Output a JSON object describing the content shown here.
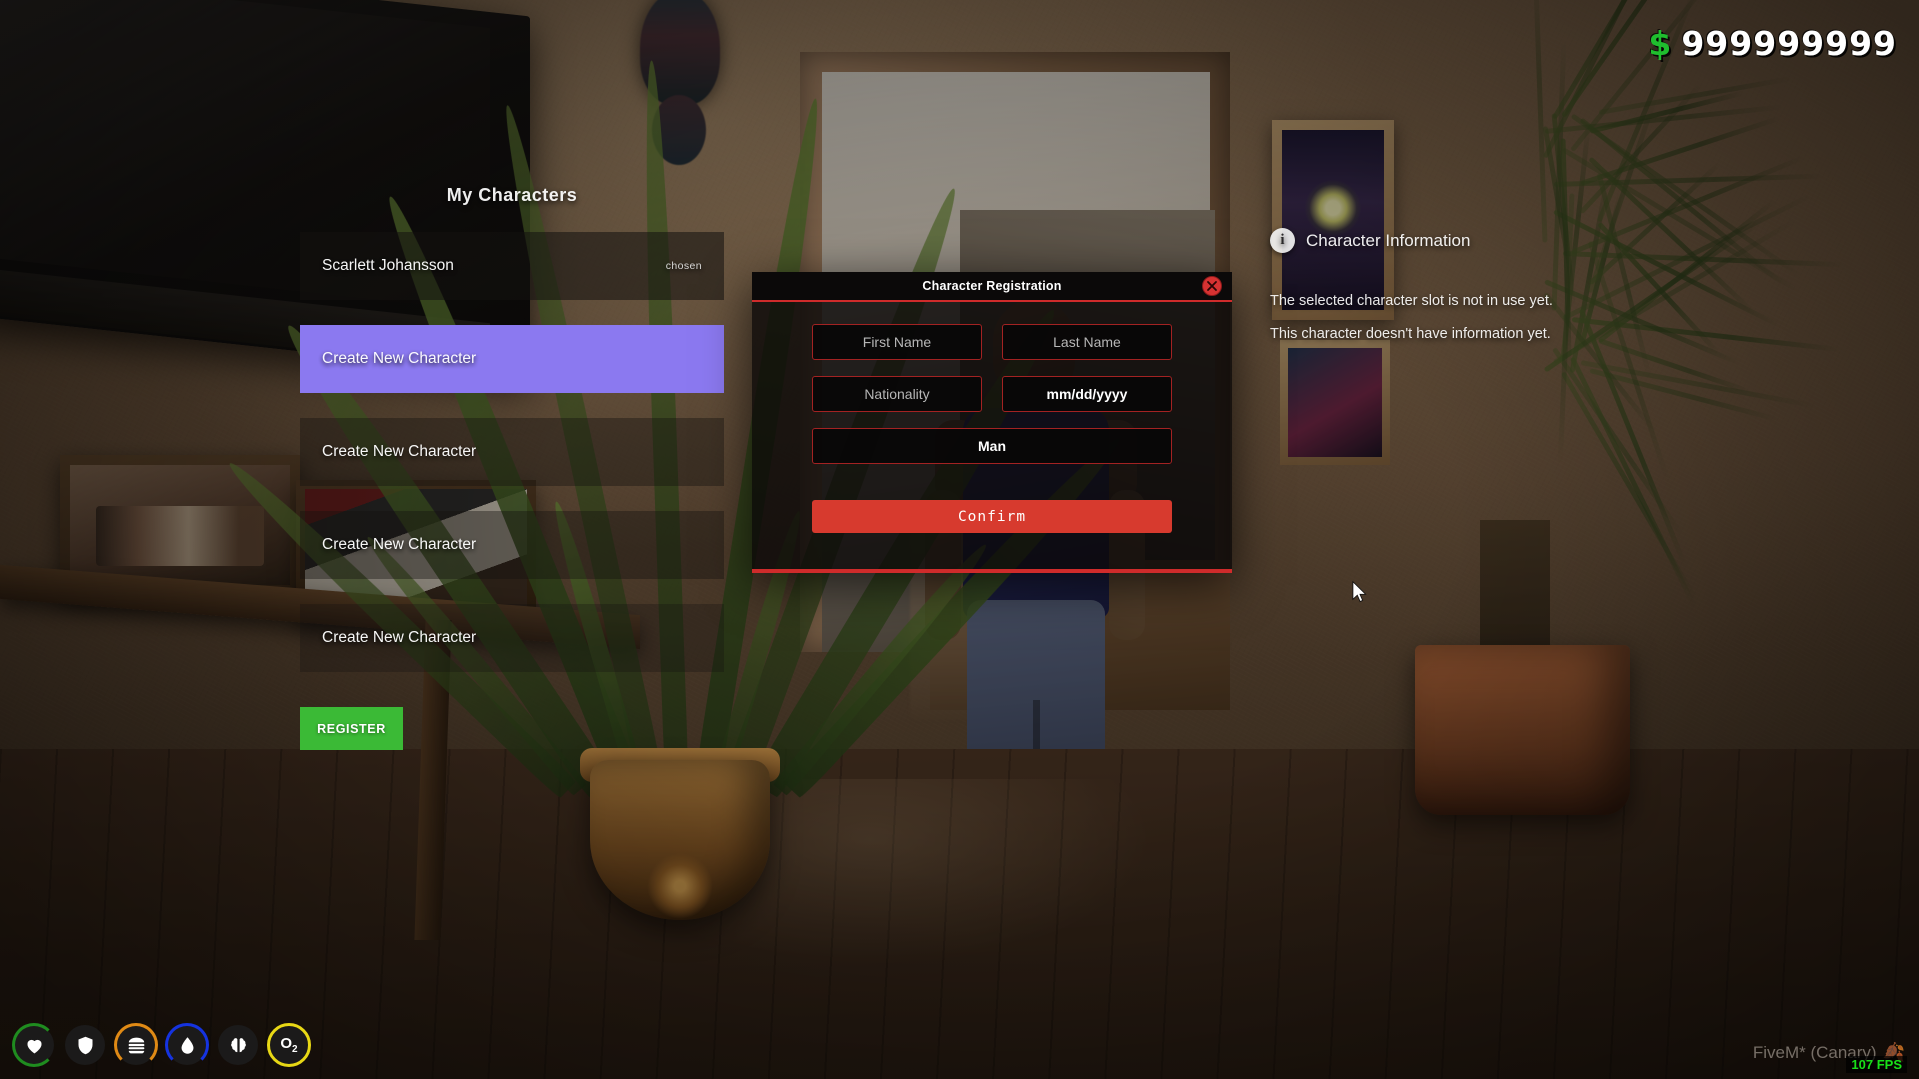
{
  "hud": {
    "money": {
      "symbol": "$",
      "amount": "999999999"
    },
    "status_icons": [
      {
        "name": "health-icon",
        "ring_color": "#1f8c1f",
        "glyph": "heart"
      },
      {
        "name": "armor-icon",
        "ring_color": "none",
        "glyph": "shield"
      },
      {
        "name": "hunger-icon",
        "ring_color": "#e08a15",
        "glyph": "burger"
      },
      {
        "name": "thirst-icon",
        "ring_color": "#1533e0",
        "glyph": "drop"
      },
      {
        "name": "stress-icon",
        "ring_color": "none",
        "glyph": "brain"
      },
      {
        "name": "oxygen-icon",
        "ring_color": "#e8d815",
        "glyph": "o2"
      }
    ],
    "brand": "FiveM* (Canary)",
    "fps": "107 FPS"
  },
  "characters_panel": {
    "title": "My Characters",
    "rows": [
      {
        "label": "Scarlett Johansson",
        "tag": "chosen",
        "selected": false
      },
      {
        "label": "Create New Character",
        "tag": "",
        "selected": true
      },
      {
        "label": "Create New Character",
        "tag": "",
        "selected": false
      },
      {
        "label": "Create New Character",
        "tag": "",
        "selected": false
      },
      {
        "label": "Create New Character",
        "tag": "",
        "selected": false
      }
    ],
    "register_button": "REGISTER",
    "register_color": "#3bba36",
    "selected_color": "#8b79f0"
  },
  "info_panel": {
    "heading": "Character Information",
    "info_glyph": "i",
    "lines": [
      "The selected character slot is not in use yet.",
      "This character doesn't have information yet."
    ]
  },
  "modal": {
    "title": "Character Registration",
    "close_label": "×",
    "accent_color": "#cf2b2b",
    "fields": [
      {
        "name": "first-name-field",
        "placeholder": "First Name",
        "value": ""
      },
      {
        "name": "last-name-field",
        "placeholder": "Last Name",
        "value": ""
      },
      {
        "name": "nationality-field",
        "placeholder": "Nationality",
        "value": ""
      },
      {
        "name": "date-of-birth-field",
        "placeholder": "mm/dd/yyyy",
        "value": "mm/dd/yyyy"
      },
      {
        "name": "gender-select",
        "placeholder": "Man",
        "value": "Man"
      }
    ],
    "confirm_label": "Confirm",
    "confirm_color": "#d73a2e"
  }
}
